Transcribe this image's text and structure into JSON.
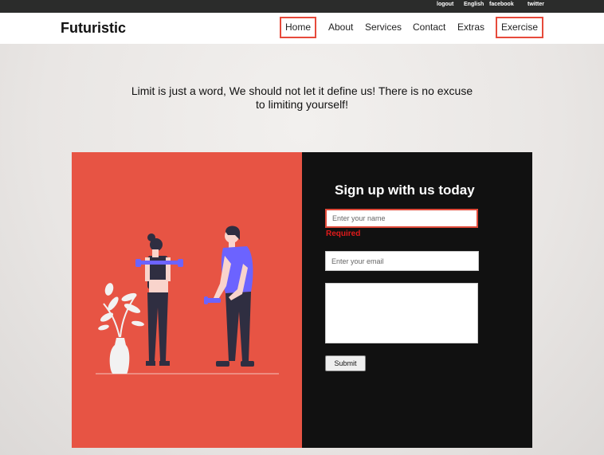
{
  "topbar": {
    "links": [
      "logout",
      "English",
      "facebook",
      "twitter"
    ]
  },
  "navbar": {
    "brand": "Futuristic",
    "links": [
      "Home",
      "About",
      "Services",
      "Contact",
      "Extras",
      "Exercise"
    ],
    "highlight_color": "#e64a3b"
  },
  "hero": {
    "quote": "Limit is just a word, We should not let it define us! There is no excuse to limiting yourself!"
  },
  "signup": {
    "title": "Sign up with us today",
    "name_placeholder": "Enter your name",
    "name_error": "Required",
    "email_placeholder": "Enter your email",
    "message_value": "",
    "submit_label": "Submit"
  },
  "colors": {
    "left_panel": "#e75444",
    "right_panel": "#111111",
    "accent_figure": "#6c63ff",
    "error": "#e01b1b"
  }
}
